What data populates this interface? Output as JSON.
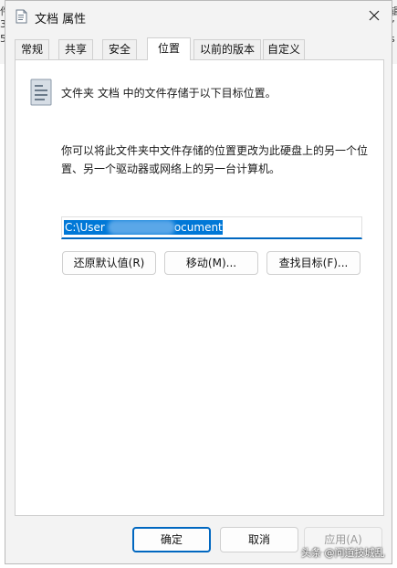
{
  "background": {
    "left_fragments": [
      "件",
      "3-",
      "5"
    ],
    "right_fragments": [
      "辑",
      "”",
      "s"
    ]
  },
  "window": {
    "title": "文档 属性"
  },
  "tabs": [
    {
      "label": "常规",
      "active": false
    },
    {
      "label": "共享",
      "active": false
    },
    {
      "label": "安全",
      "active": false
    },
    {
      "label": "位置",
      "active": true
    },
    {
      "label": "以前的版本",
      "active": false
    },
    {
      "label": "自定义",
      "active": false
    }
  ],
  "location": {
    "intro": "文件夹 文档 中的文件存储于以下目标位置。",
    "explanation": "你可以将此文件夹中文件存储的位置更改为此硬盘上的另一个位置、另一个驱动器或网络上的另一台计算机。",
    "path_start": "C:\\User",
    "path_end": "ocuments",
    "restore_label": "还原默认值(R)",
    "move_label": "移动(M)...",
    "find_label": "查找目标(F)..."
  },
  "footer": {
    "ok_label": "确定",
    "cancel_label": "取消",
    "apply_label": "应用(A)"
  },
  "watermark": "头条 @问道技城乱",
  "colors": {
    "accent": "#0067c0",
    "selection": "#0078d7"
  }
}
